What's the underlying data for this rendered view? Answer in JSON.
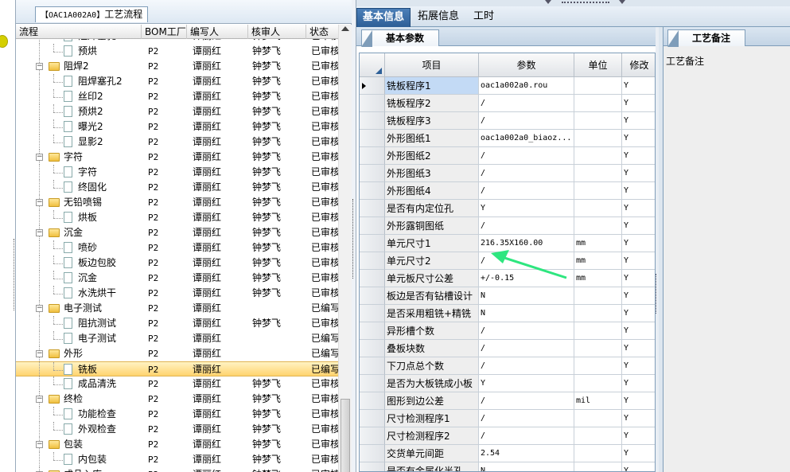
{
  "tree": {
    "tab_label": "工艺流程",
    "tab_code": "【OAC1A002A0】",
    "columns": [
      "流程",
      "BOM工厂",
      "编写人",
      "核审人",
      "状态"
    ],
    "rows": [
      {
        "name": "阻焊塞孔",
        "type": "doc",
        "level": 2,
        "bom": "P2",
        "writer": "谭丽红",
        "checker": "钟梦飞",
        "status": "已审核"
      },
      {
        "name": "预烘",
        "type": "doc",
        "level": 2,
        "bom": "P2",
        "writer": "谭丽红",
        "checker": "钟梦飞",
        "status": "已审核"
      },
      {
        "name": "阻焊2",
        "type": "folder",
        "level": 1,
        "bom": "P2",
        "writer": "谭丽红",
        "checker": "钟梦飞",
        "status": "已审核"
      },
      {
        "name": "阻焊塞孔2",
        "type": "doc",
        "level": 2,
        "bom": "P2",
        "writer": "谭丽红",
        "checker": "钟梦飞",
        "status": "已审核"
      },
      {
        "name": "丝印2",
        "type": "doc",
        "level": 2,
        "bom": "P2",
        "writer": "谭丽红",
        "checker": "钟梦飞",
        "status": "已审核"
      },
      {
        "name": "预烘2",
        "type": "doc",
        "level": 2,
        "bom": "P2",
        "writer": "谭丽红",
        "checker": "钟梦飞",
        "status": "已审核"
      },
      {
        "name": "曝光2",
        "type": "doc",
        "level": 2,
        "bom": "P2",
        "writer": "谭丽红",
        "checker": "钟梦飞",
        "status": "已审核"
      },
      {
        "name": "显影2",
        "type": "doc",
        "level": 2,
        "bom": "P2",
        "writer": "谭丽红",
        "checker": "钟梦飞",
        "status": "已审核"
      },
      {
        "name": "字符",
        "type": "folder",
        "level": 1,
        "bom": "P2",
        "writer": "谭丽红",
        "checker": "钟梦飞",
        "status": "已审核"
      },
      {
        "name": "字符",
        "type": "doc",
        "level": 2,
        "bom": "P2",
        "writer": "谭丽红",
        "checker": "钟梦飞",
        "status": "已审核"
      },
      {
        "name": "终固化",
        "type": "doc",
        "level": 2,
        "bom": "P2",
        "writer": "谭丽红",
        "checker": "钟梦飞",
        "status": "已审核"
      },
      {
        "name": "无铅喷锡",
        "type": "folder",
        "level": 1,
        "bom": "P2",
        "writer": "谭丽红",
        "checker": "钟梦飞",
        "status": "已审核"
      },
      {
        "name": "烘板",
        "type": "doc",
        "level": 2,
        "bom": "P2",
        "writer": "谭丽红",
        "checker": "钟梦飞",
        "status": "已审核"
      },
      {
        "name": "沉金",
        "type": "folder",
        "level": 1,
        "bom": "P2",
        "writer": "谭丽红",
        "checker": "钟梦飞",
        "status": "已审核"
      },
      {
        "name": "喷砂",
        "type": "doc",
        "level": 2,
        "bom": "P2",
        "writer": "谭丽红",
        "checker": "钟梦飞",
        "status": "已审核"
      },
      {
        "name": "板边包胶",
        "type": "doc",
        "level": 2,
        "bom": "P2",
        "writer": "谭丽红",
        "checker": "钟梦飞",
        "status": "已审核"
      },
      {
        "name": "沉金",
        "type": "doc",
        "level": 2,
        "bom": "P2",
        "writer": "谭丽红",
        "checker": "钟梦飞",
        "status": "已审核"
      },
      {
        "name": "水洗烘干",
        "type": "doc",
        "level": 2,
        "bom": "P2",
        "writer": "谭丽红",
        "checker": "钟梦飞",
        "status": "已审核"
      },
      {
        "name": "电子测试",
        "type": "folder",
        "level": 1,
        "bom": "P2",
        "writer": "谭丽红",
        "checker": "",
        "status": "已编写"
      },
      {
        "name": "阻抗测试",
        "type": "doc",
        "level": 2,
        "bom": "P2",
        "writer": "谭丽红",
        "checker": "钟梦飞",
        "status": "已审核"
      },
      {
        "name": "电子测试",
        "type": "doc",
        "level": 2,
        "bom": "P2",
        "writer": "谭丽红",
        "checker": "",
        "status": "已编写"
      },
      {
        "name": "外形",
        "type": "folder",
        "level": 1,
        "bom": "P2",
        "writer": "谭丽红",
        "checker": "",
        "status": "已编写"
      },
      {
        "name": "铣板",
        "type": "doc",
        "level": 2,
        "bom": "P2",
        "writer": "谭丽红",
        "checker": "",
        "status": "已编写",
        "selected": true
      },
      {
        "name": "成品清洗",
        "type": "doc",
        "level": 2,
        "bom": "P2",
        "writer": "谭丽红",
        "checker": "钟梦飞",
        "status": "已审核"
      },
      {
        "name": "终检",
        "type": "folder",
        "level": 1,
        "bom": "P2",
        "writer": "谭丽红",
        "checker": "钟梦飞",
        "status": "已审核"
      },
      {
        "name": "功能检查",
        "type": "doc",
        "level": 2,
        "bom": "P2",
        "writer": "谭丽红",
        "checker": "钟梦飞",
        "status": "已审核"
      },
      {
        "name": "外观检查",
        "type": "doc",
        "level": 2,
        "bom": "P2",
        "writer": "谭丽红",
        "checker": "钟梦飞",
        "status": "已审核"
      },
      {
        "name": "包装",
        "type": "folder",
        "level": 1,
        "bom": "P2",
        "writer": "谭丽红",
        "checker": "钟梦飞",
        "status": "已审核"
      },
      {
        "name": "内包装",
        "type": "doc",
        "level": 2,
        "bom": "P2",
        "writer": "谭丽红",
        "checker": "钟梦飞",
        "status": "已审核"
      },
      {
        "name": "成品入库",
        "type": "folder",
        "level": 1,
        "bom": "P2",
        "writer": "谭丽红",
        "checker": "钟梦飞",
        "status": "已审核"
      }
    ]
  },
  "main_tabs": [
    "基本信息",
    "拓展信息",
    "工时"
  ],
  "params": {
    "panel_tab": "基本参数",
    "columns": [
      "项目",
      "参数",
      "单位",
      "修改"
    ],
    "rows": [
      {
        "item": "铣板程序1",
        "param": "oac1a002a0.rou",
        "unit": "",
        "mod": "Y",
        "current": true
      },
      {
        "item": "铣板程序2",
        "param": "/",
        "unit": "",
        "mod": "Y"
      },
      {
        "item": "铣板程序3",
        "param": "/",
        "unit": "",
        "mod": "Y"
      },
      {
        "item": "外形图纸1",
        "param": "oac1a002a0_biaoz...",
        "unit": "",
        "mod": "Y"
      },
      {
        "item": "外形图纸2",
        "param": "/",
        "unit": "",
        "mod": "Y"
      },
      {
        "item": "外形图纸3",
        "param": "/",
        "unit": "",
        "mod": "Y"
      },
      {
        "item": "外形图纸4",
        "param": "/",
        "unit": "",
        "mod": "Y"
      },
      {
        "item": "是否有内定位孔",
        "param": "Y",
        "unit": "",
        "mod": "Y"
      },
      {
        "item": "外形露铜图纸",
        "param": "/",
        "unit": "",
        "mod": "Y"
      },
      {
        "item": "单元尺寸1",
        "param": "216.35X160.00",
        "unit": "mm",
        "mod": "Y"
      },
      {
        "item": "单元尺寸2",
        "param": "/",
        "unit": "mm",
        "mod": "Y"
      },
      {
        "item": "单元板尺寸公差",
        "param": "+/-0.15",
        "unit": "mm",
        "mod": "Y"
      },
      {
        "item": "板边是否有钻槽设计",
        "param": "N",
        "unit": "",
        "mod": "Y"
      },
      {
        "item": "是否采用粗铣+精铣",
        "param": "N",
        "unit": "",
        "mod": "Y"
      },
      {
        "item": "异形槽个数",
        "param": "/",
        "unit": "",
        "mod": "Y"
      },
      {
        "item": "叠板块数",
        "param": "/",
        "unit": "",
        "mod": "Y"
      },
      {
        "item": "下刀点总个数",
        "param": "/",
        "unit": "",
        "mod": "Y"
      },
      {
        "item": "是否为大板铣成小板",
        "param": "Y",
        "unit": "",
        "mod": "Y"
      },
      {
        "item": "图形到边公差",
        "param": "/",
        "unit": "mil",
        "mod": "Y"
      },
      {
        "item": "尺寸检测程序1",
        "param": "/",
        "unit": "",
        "mod": "Y"
      },
      {
        "item": "尺寸检测程序2",
        "param": "/",
        "unit": "",
        "mod": "Y"
      },
      {
        "item": "交货单元间距",
        "param": "2.54",
        "unit": "",
        "mod": "Y"
      },
      {
        "item": "是否有金属化半孔",
        "param": "N",
        "unit": "",
        "mod": "Y"
      }
    ]
  },
  "notes": {
    "tab": "工艺备注",
    "label": "工艺备注"
  },
  "colors": {
    "active_tab": "#2d5f97",
    "selected_row": "#ffd36f",
    "arrow": "#2ee67f",
    "folder": "#f0c040"
  }
}
